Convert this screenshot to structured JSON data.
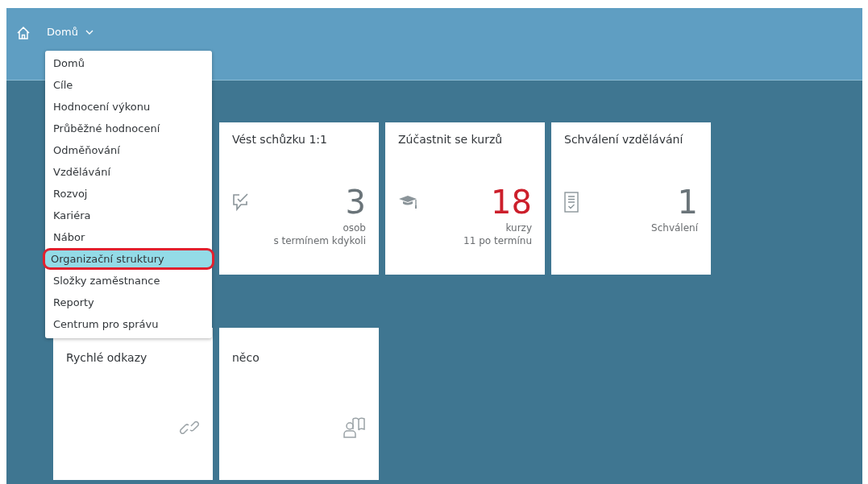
{
  "header": {
    "title": "Domů"
  },
  "menu": {
    "items": [
      {
        "label": "Domů",
        "selected": false
      },
      {
        "label": "Cíle",
        "selected": false
      },
      {
        "label": "Hodnocení výkonu",
        "selected": false
      },
      {
        "label": "Průběžné hodnocení",
        "selected": false
      },
      {
        "label": "Odměňování",
        "selected": false
      },
      {
        "label": "Vzdělávání",
        "selected": false
      },
      {
        "label": "Rozvoj",
        "selected": false
      },
      {
        "label": "Kariéra",
        "selected": false
      },
      {
        "label": "Nábor",
        "selected": false
      },
      {
        "label": "Organizační struktury",
        "selected": true
      },
      {
        "label": "Složky zaměstnance",
        "selected": false
      },
      {
        "label": "Reporty",
        "selected": false
      },
      {
        "label": "Centrum pro správu",
        "selected": false
      }
    ]
  },
  "tiles": [
    {
      "title": "Vést schůzku 1:1",
      "kind": "chat-check",
      "number": "3",
      "alert": false,
      "lines": [
        "osob",
        "s termínem kdykoli"
      ]
    },
    {
      "title": "Zúčastnit se kurzů",
      "kind": "graduation",
      "number": "18",
      "alert": true,
      "lines": [
        "kurzy",
        "11 po termínu"
      ]
    },
    {
      "title": "Schválení vzdělávání",
      "kind": "document-check",
      "number": "1",
      "alert": false,
      "lines": [
        "Schválení"
      ]
    }
  ],
  "tiles_row_2": [
    {
      "title": "Rychlé odkazy",
      "kind": "link"
    },
    {
      "title": "něco",
      "kind": "person-book"
    }
  ]
}
